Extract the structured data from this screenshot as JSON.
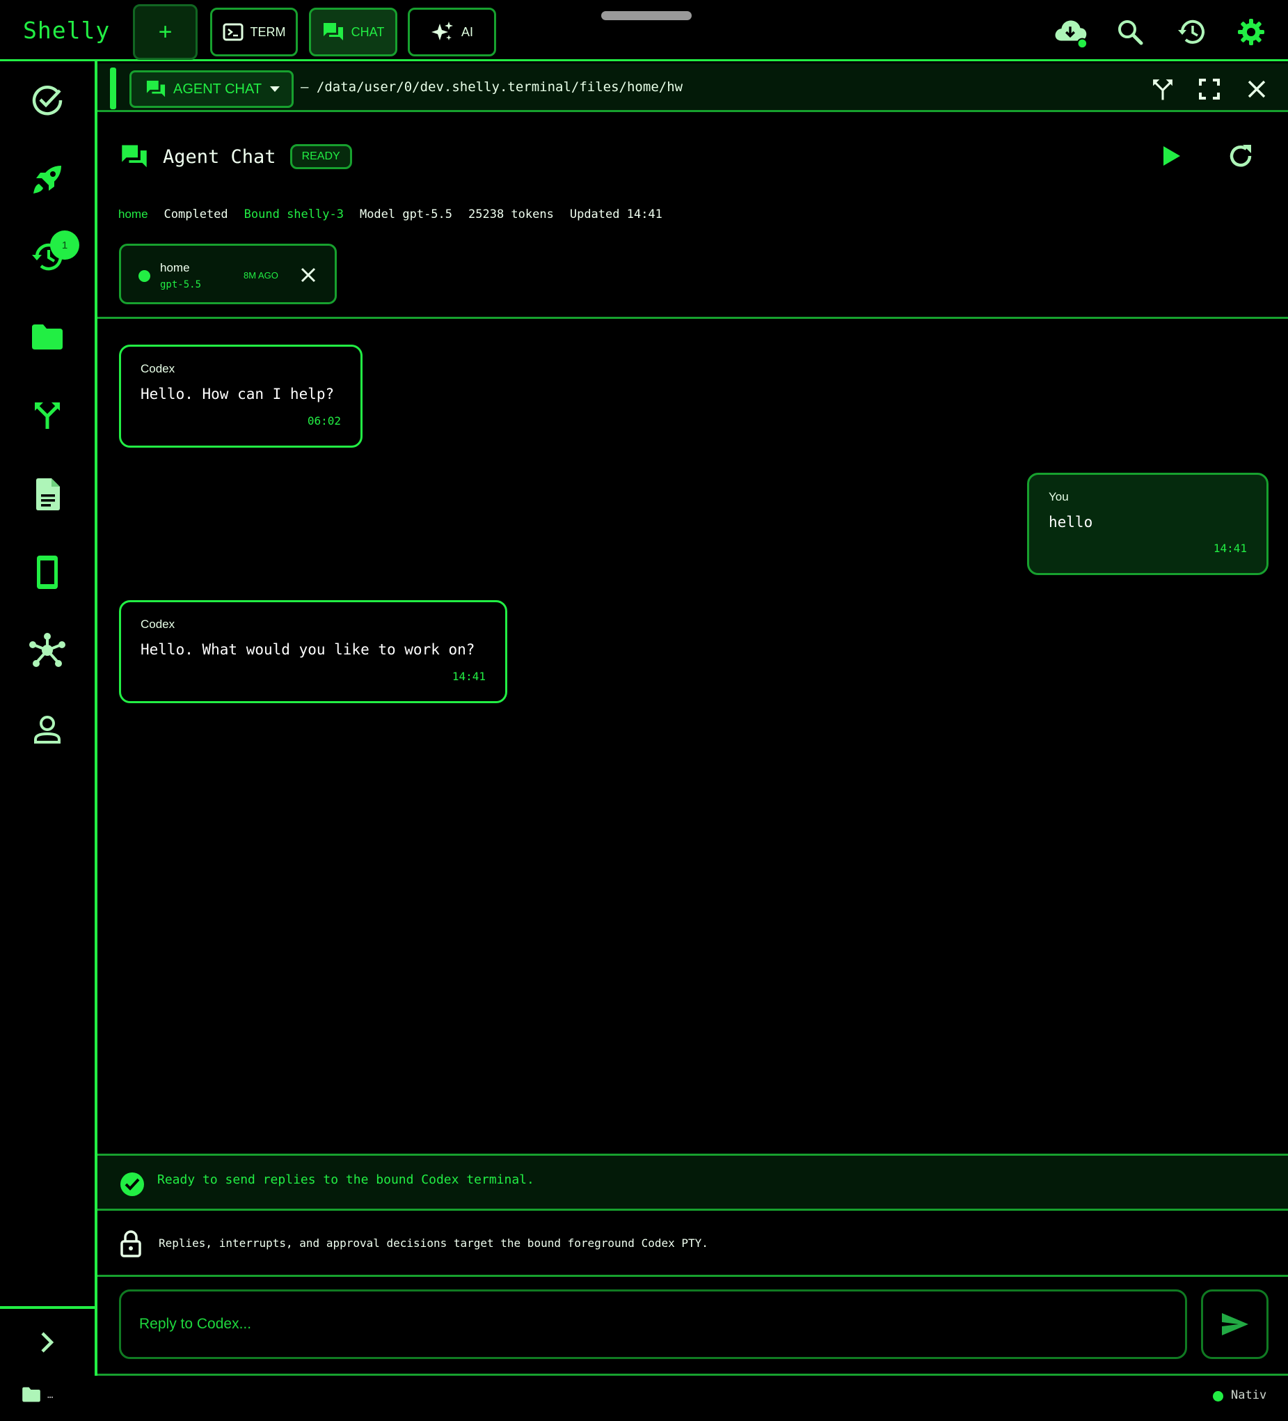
{
  "app": {
    "name": "Shelly"
  },
  "toolbar": {
    "new_label": "+",
    "term_label": "TERM",
    "chat_label": "CHAT",
    "ai_label": "AI"
  },
  "sidebar": {
    "history_badge": "1"
  },
  "panel": {
    "mode_label": "AGENT CHAT",
    "path": "— /data/user/0/dev.shelly.terminal/files/home/hw"
  },
  "chat": {
    "title": "Agent Chat",
    "status": "READY",
    "meta": {
      "folder": "home",
      "state": "Completed",
      "bound": "Bound shelly-3",
      "model": "Model gpt-5.5",
      "tokens": "25238 tokens",
      "updated": "Updated 14:41"
    },
    "session": {
      "name": "home",
      "model": "gpt-5.5",
      "age": "8M AGO"
    },
    "messages": [
      {
        "author": "Codex",
        "text": "Hello. How can I help?",
        "time": "06:02"
      },
      {
        "author": "You",
        "text": "hello",
        "time": "14:41"
      },
      {
        "author": "Codex",
        "text": "Hello. What would you like to work on?",
        "time": "14:41"
      }
    ],
    "ready_text": "Ready to send replies to the bound Codex terminal.",
    "notice_text": "Replies, interrupts, and approval decisions target the bound foreground Codex PTY.",
    "input_placeholder": "Reply to Codex..."
  },
  "statusbar": {
    "ellipsis": "…",
    "connection": "Nativ"
  },
  "colors": {
    "accent": "#22ee44",
    "accent_dark": "#0c3a14",
    "background": "#000000"
  }
}
